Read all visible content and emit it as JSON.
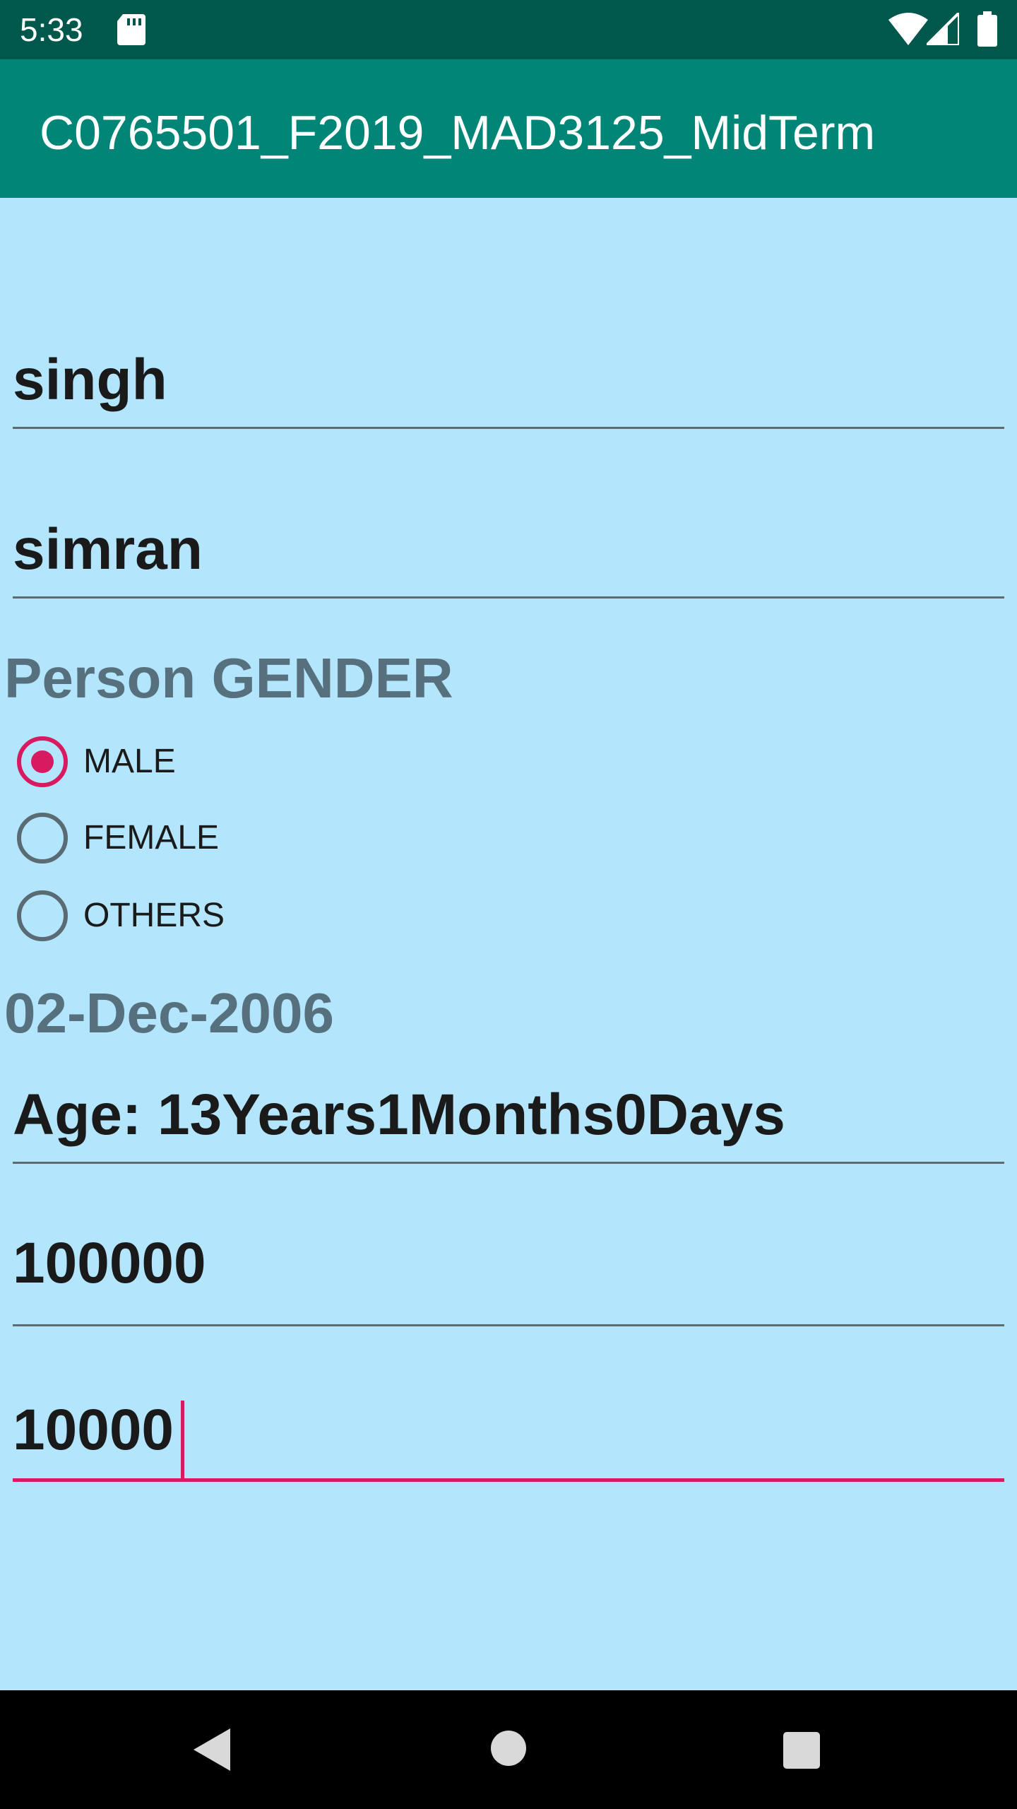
{
  "status_bar": {
    "time": "5:33",
    "icons": [
      "sd-card-icon",
      "wifi-icon",
      "signal-icon",
      "battery-icon"
    ]
  },
  "app_bar": {
    "title": "C0765501_F2019_MAD3125_MidTerm",
    "color": "#008577"
  },
  "form": {
    "last_name": "singh",
    "first_name": "simran",
    "gender_label": "Person GENDER",
    "gender_options": [
      {
        "label": "MALE",
        "checked": true
      },
      {
        "label": "FEMALE",
        "checked": false
      },
      {
        "label": "OTHERS",
        "checked": false
      }
    ],
    "birth_date": "02-Dec-2006",
    "age": "Age: 13Years1Months0Days",
    "salary": "100000",
    "bonus": "10000"
  },
  "colors": {
    "status_bar": "#00574B",
    "background": "#B3E5FC",
    "accent": "#D81B60"
  },
  "nav_bar": {
    "icons": [
      "back-icon",
      "home-icon",
      "recents-icon"
    ]
  }
}
